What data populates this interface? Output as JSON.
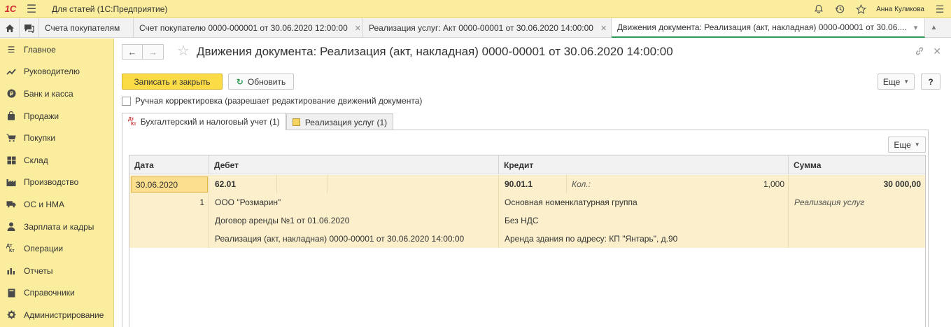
{
  "topbar": {
    "logo": "1С",
    "app_title": "Для статей  (1С:Предприятие)",
    "user": "Анна Куликова"
  },
  "window_tabs": [
    {
      "label": "Счета покупателям"
    },
    {
      "label": "Счет покупателю 0000-000001 от 30.06.2020 12:00:00"
    },
    {
      "label": "Реализация услуг: Акт 0000-00001 от 30.06.2020 14:00:00"
    },
    {
      "label": "Движения документа: Реализация (акт, накладная) 0000-00001 от 30.06...."
    }
  ],
  "sidebar": {
    "items": [
      {
        "label": "Главное",
        "icon": "menu-icon"
      },
      {
        "label": "Руководителю",
        "icon": "trend-icon"
      },
      {
        "label": "Банк и касса",
        "icon": "coin-icon"
      },
      {
        "label": "Продажи",
        "icon": "bag-icon"
      },
      {
        "label": "Покупки",
        "icon": "cart-icon"
      },
      {
        "label": "Склад",
        "icon": "warehouse-icon"
      },
      {
        "label": "Производство",
        "icon": "factory-icon"
      },
      {
        "label": "ОС и НМА",
        "icon": "truck-icon"
      },
      {
        "label": "Зарплата и кадры",
        "icon": "person-icon"
      },
      {
        "label": "Операции",
        "icon": "dt-kt-icon"
      },
      {
        "label": "Отчеты",
        "icon": "bar-chart-icon"
      },
      {
        "label": "Справочники",
        "icon": "book-icon"
      },
      {
        "label": "Администрирование",
        "icon": "gear-icon"
      }
    ]
  },
  "document": {
    "title": "Движения документа: Реализация (акт, накладная) 0000-00001 от 30.06.2020 14:00:00",
    "save_close_label": "Записать и закрыть",
    "refresh_label": "Обновить",
    "more_label": "Еще",
    "help_label": "?",
    "manual_edit_label": "Ручная корректировка (разрешает редактирование движений документа)",
    "tabs": [
      {
        "label": "Бухгалтерский и налоговый учет (1)"
      },
      {
        "label": "Реализация услуг (1)"
      }
    ],
    "dt_kt": {
      "dt": "Дт",
      "kt": "Кт"
    }
  },
  "grid": {
    "more_label": "Еще",
    "headers": [
      "Дата",
      "Дебет",
      "Кредит",
      "Сумма"
    ],
    "row": {
      "date": "30.06.2020",
      "line_no": "1",
      "debit_account": "62.01",
      "debit_sub1": "ООО \"Розмарин\"",
      "debit_sub2": "Договор аренды №1 от 01.06.2020",
      "debit_sub3": "Реализация (акт, накладная) 0000-00001 от 30.06.2020 14:00:00",
      "credit_account": "90.01.1",
      "credit_qty_label": "Кол.:",
      "credit_qty": "1,000",
      "credit_sub1": "Основная номенклатурная группа",
      "credit_sub2": "Без НДС",
      "credit_sub3": "Аренда здания по адресу: КП \"Янтарь\", д.90",
      "amount": "30 000,00",
      "amount_note": "Реализация услуг"
    }
  }
}
